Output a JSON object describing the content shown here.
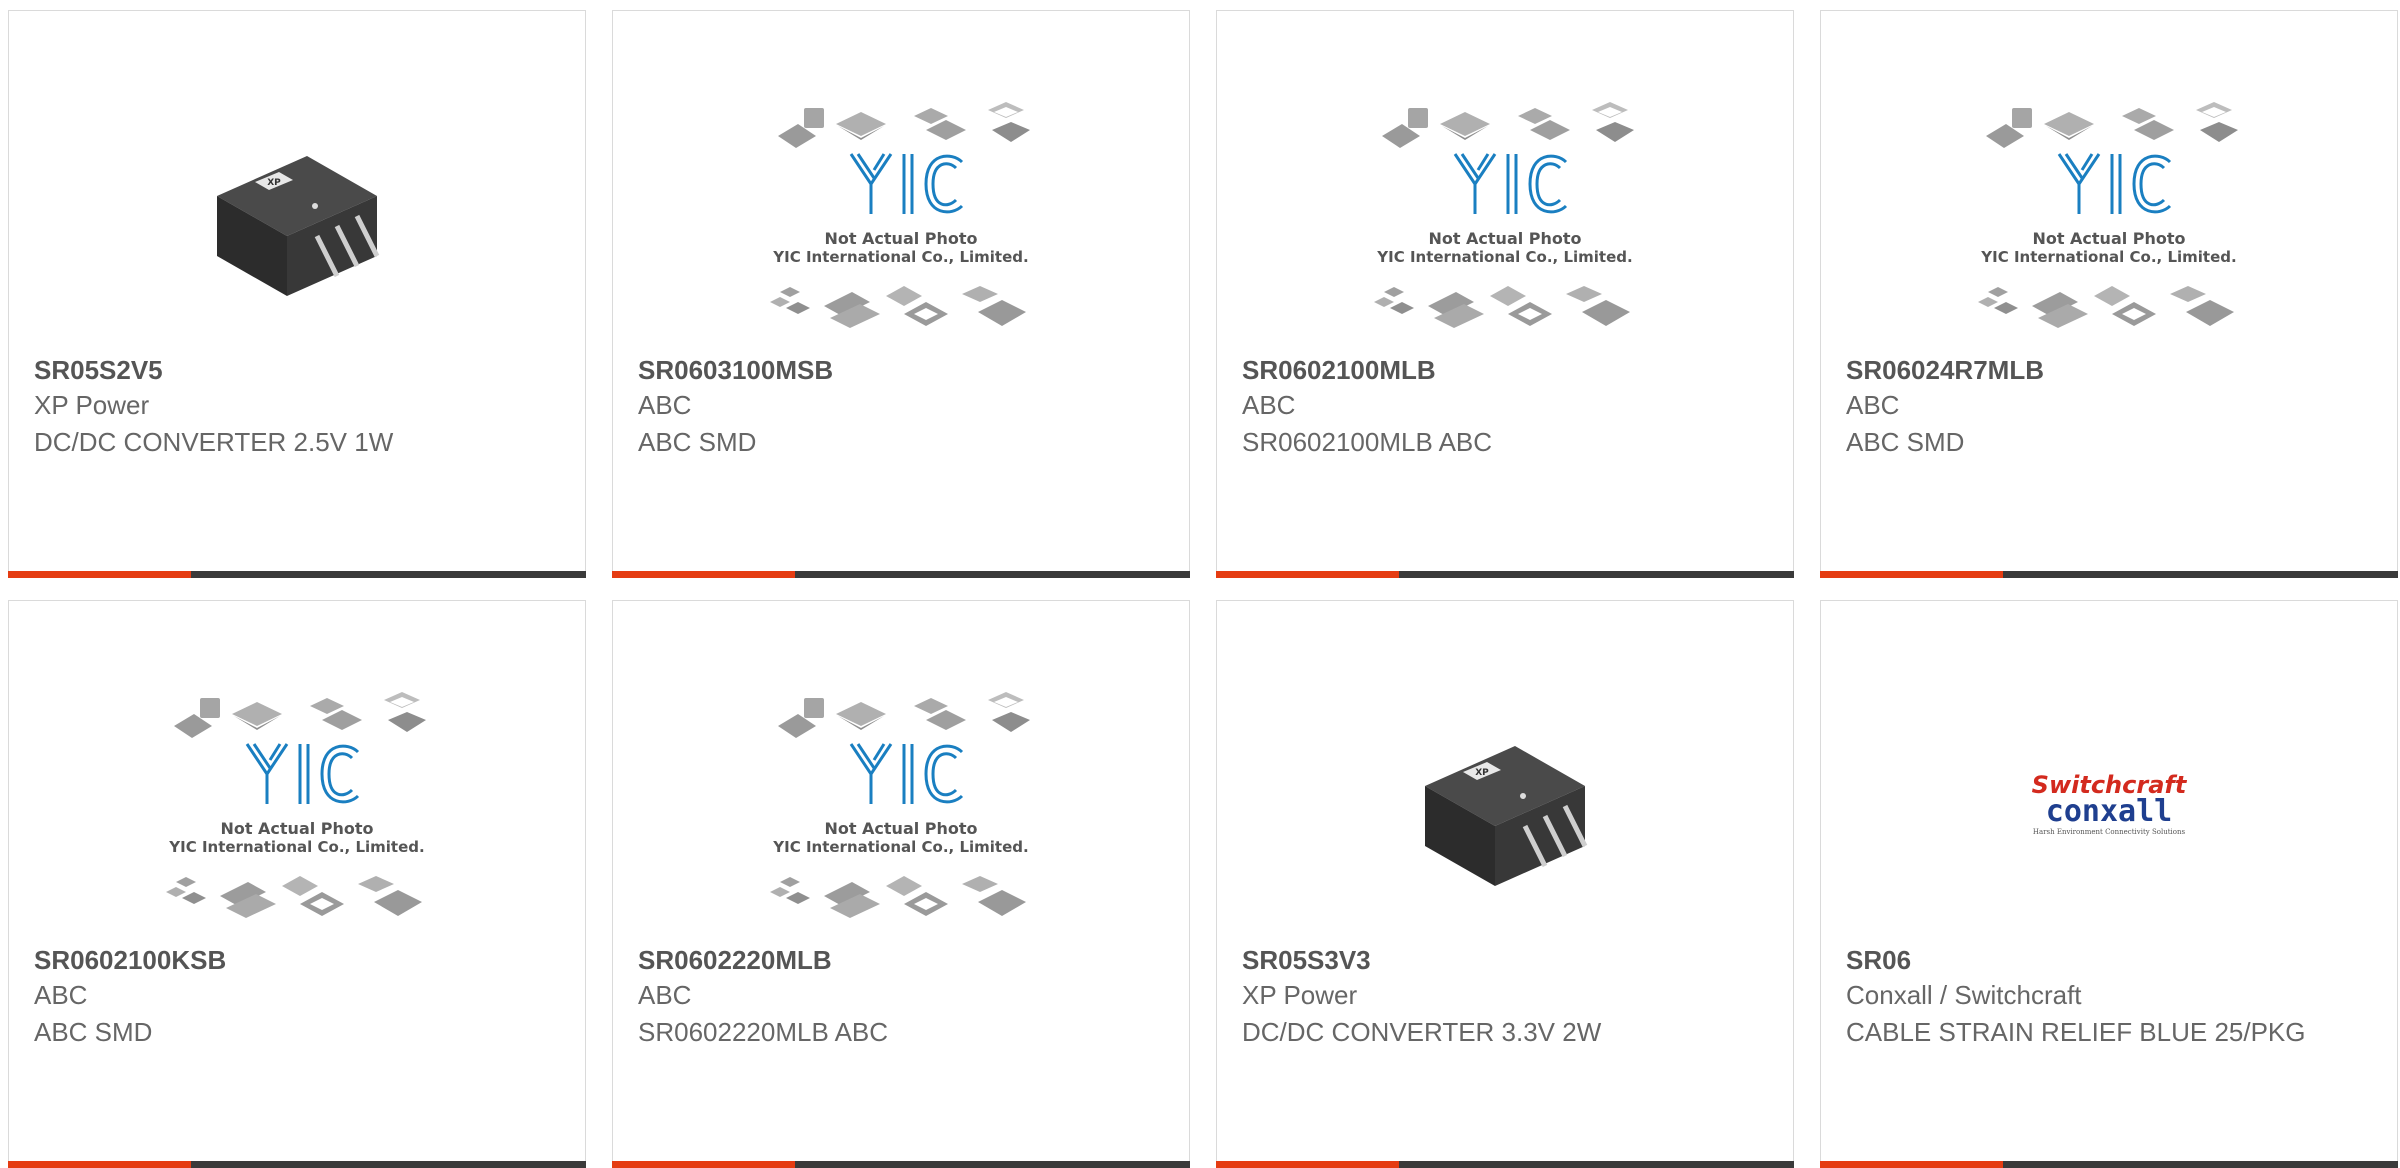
{
  "colors": {
    "accent": "#e53c12",
    "bar": "#3a3a3a",
    "yic_blue": "#1a7fc1"
  },
  "products": [
    {
      "part": "SR05S2V5",
      "manufacturer": "XP Power",
      "description": "DC/DC CONVERTER 2.5V 1W",
      "image": "xp-power-module"
    },
    {
      "part": "SR0603100MSB",
      "manufacturer": "ABC",
      "description": "ABC SMD",
      "image": "yic-placeholder"
    },
    {
      "part": "SR0602100MLB",
      "manufacturer": "ABC",
      "description": "SR0602100MLB ABC",
      "image": "yic-placeholder"
    },
    {
      "part": "SR06024R7MLB",
      "manufacturer": "ABC",
      "description": "ABC SMD",
      "image": "yic-placeholder"
    },
    {
      "part": "SR0602100KSB",
      "manufacturer": "ABC",
      "description": "ABC SMD",
      "image": "yic-placeholder"
    },
    {
      "part": "SR0602220MLB",
      "manufacturer": "ABC",
      "description": "SR0602220MLB ABC",
      "image": "yic-placeholder"
    },
    {
      "part": "SR05S3V3",
      "manufacturer": "XP Power",
      "description": "DC/DC CONVERTER 3.3V 2W",
      "image": "xp-power-module"
    },
    {
      "part": "SR06",
      "manufacturer": "Conxall / Switchcraft",
      "description": "CABLE STRAIN RELIEF BLUE 25/PKG",
      "image": "switchcraft-conxall-logo"
    }
  ],
  "placeholder": {
    "logo": "YIC",
    "line1": "Not Actual Photo",
    "line2": "YIC International Co., Limited."
  },
  "brand_logo": {
    "top": "Switchcraft",
    "bottom": "conxall",
    "tagline": "Harsh Environment Connectivity Solutions"
  }
}
